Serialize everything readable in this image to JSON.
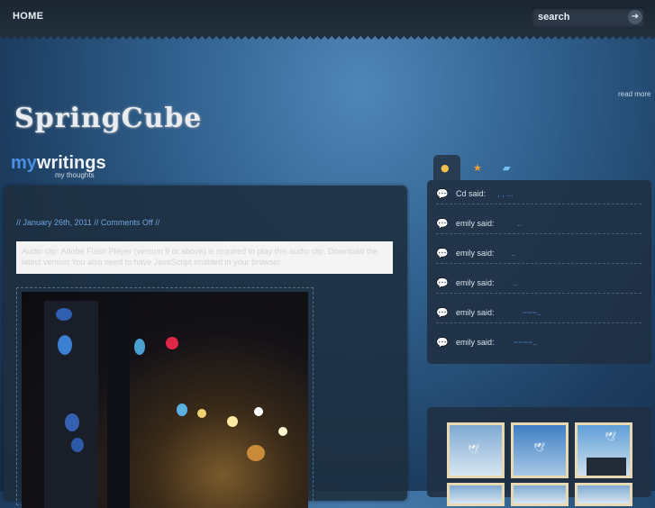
{
  "nav": {
    "home_label": "HOME"
  },
  "search": {
    "label": "search",
    "go_glyph": "➜"
  },
  "header": {
    "read_more": "read more",
    "site_title": "SpringCube"
  },
  "section": {
    "title_part1": "my",
    "title_part2": "writings",
    "subtitle": "my thoughts"
  },
  "post": {
    "meta": "// January 26th, 2011 // Comments Off //",
    "notice": "Audio clip: Adobe Flash Player (version 9 or above) is required to play this audio clip. Download the latest version            You also need to have JavaScript enabled in your browser."
  },
  "sidebar": {
    "tabs": [
      {
        "icon": "chat-bubbles-icon"
      },
      {
        "icon": "star-icon"
      },
      {
        "icon": "photo-icon"
      }
    ],
    "comments": [
      {
        "author": "Cd said:",
        "text": ",  ,       ..."
      },
      {
        "author": "emily said:",
        "text": ".."
      },
      {
        "author": "emily said:",
        "text": ".."
      },
      {
        "author": "emily said:",
        "text": ".."
      },
      {
        "author": "emily said:",
        "text": "~~~.."
      },
      {
        "author": "emily said:",
        "text": "~~~~.."
      }
    ]
  },
  "colors": {
    "accent": "#4a90e2",
    "topbar": "#1f2a36",
    "panel": "#203042"
  }
}
